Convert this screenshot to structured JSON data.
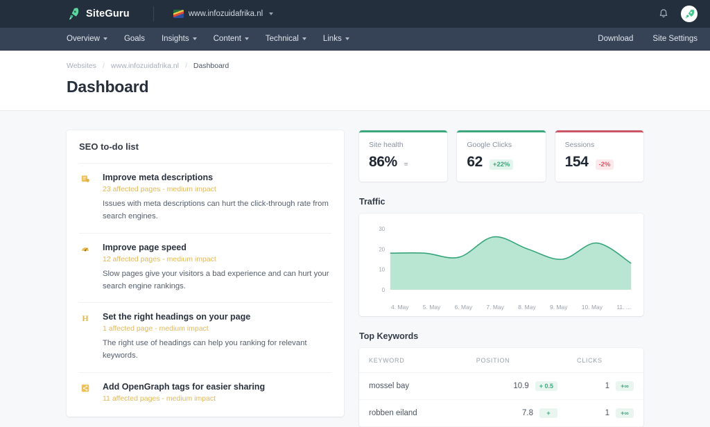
{
  "topbar": {
    "brand_name": "SiteGuru",
    "brand_icon": "rocket-icon",
    "site_url": "www.infozuidafrika.nl",
    "site_flag_icon": "south-africa-flag-icon",
    "dropdown_icon": "chevron-down-icon",
    "notification_icon": "bell-icon",
    "avatar_icon": "rocket-avatar-icon"
  },
  "nav": {
    "items": [
      {
        "label": "Overview",
        "has_dropdown": true
      },
      {
        "label": "Goals",
        "has_dropdown": false
      },
      {
        "label": "Insights",
        "has_dropdown": true
      },
      {
        "label": "Content",
        "has_dropdown": true
      },
      {
        "label": "Technical",
        "has_dropdown": true
      },
      {
        "label": "Links",
        "has_dropdown": true
      }
    ],
    "right_items": [
      {
        "label": "Download"
      },
      {
        "label": "Site Settings"
      }
    ]
  },
  "breadcrumb": {
    "items": [
      "Websites",
      "www.infozuidafrika.nl",
      "Dashboard"
    ],
    "separator": "/"
  },
  "page_title": "Dashboard",
  "todo": {
    "title": "SEO to-do list",
    "items": [
      {
        "icon": "meta-description-icon",
        "icon_letter": "",
        "title": "Improve meta descriptions",
        "meta": "23 affected pages - medium impact",
        "description": "Issues with meta descriptions can hurt the click-through rate from search engines."
      },
      {
        "icon": "speed-gauge-icon",
        "icon_letter": "",
        "title": "Improve page speed",
        "meta": "12 affected pages - medium impact",
        "description": "Slow pages give your visitors a bad experience and can hurt your search engine rankings."
      },
      {
        "icon": "heading-icon",
        "icon_letter": "H",
        "title": "Set the right headings on your page",
        "meta": "1 affected page - medium impact",
        "description": "The right use of headings can help you ranking for relevant keywords."
      },
      {
        "icon": "share-icon",
        "icon_letter": "",
        "title": "Add OpenGraph tags for easier sharing",
        "meta": "11 affected pages - medium impact",
        "description": ""
      }
    ]
  },
  "stats": [
    {
      "label": "Site health",
      "value": "86%",
      "badge": "=",
      "trend": "flat",
      "accent": "#3aa87a"
    },
    {
      "label": "Google Clicks",
      "value": "62",
      "badge": "+22%",
      "trend": "up",
      "accent": "#3aa87a"
    },
    {
      "label": "Sessions",
      "value": "154",
      "badge": "-2%",
      "trend": "down",
      "accent": "#cc5566"
    }
  ],
  "traffic": {
    "title": "Traffic"
  },
  "keywords": {
    "title": "Top Keywords",
    "columns": [
      "KEYWORD",
      "POSITION",
      "CLICKS"
    ],
    "rows": [
      {
        "keyword": "mossel bay",
        "position": "10.9",
        "position_delta": "+ 0.5",
        "clicks": "1",
        "clicks_delta": "+∞"
      },
      {
        "keyword": "robben eiland",
        "position": "7.8",
        "position_delta": "+",
        "clicks": "1",
        "clicks_delta": "+∞"
      }
    ]
  },
  "chart_data": {
    "type": "area",
    "title": "Traffic",
    "xlabel": "",
    "ylabel": "",
    "ylim": [
      0,
      30
    ],
    "yticks": [
      0,
      10,
      20,
      30
    ],
    "grid": false,
    "legend": "none",
    "x": [
      "4. May",
      "5. May",
      "6. May",
      "7. May",
      "8. May",
      "9. May",
      "10. May",
      "11. ..."
    ],
    "xtick_labels": [
      "4. May",
      "5. May",
      "6. May",
      "7. May",
      "8. May",
      "9. May",
      "10. May",
      "11. ..."
    ],
    "series": [
      {
        "name": "Sessions",
        "values": [
          18,
          18,
          16,
          26,
          20,
          15,
          23,
          13
        ],
        "line_color": "#35a579",
        "fill_color": "#b8e6d2"
      }
    ]
  }
}
